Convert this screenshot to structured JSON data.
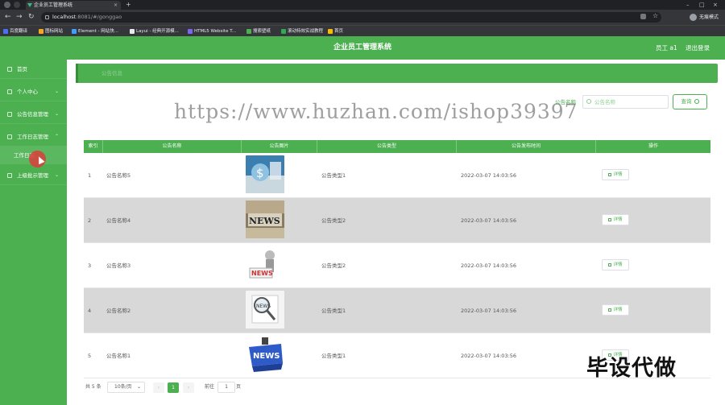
{
  "browser": {
    "tab_title": "企业员工管理系统",
    "tab_close": "×",
    "new_tab": "+",
    "url_host": "localhost",
    "url_rest": ":8081/#/gonggao",
    "profile_label": "无痕模式",
    "bookmarks": [
      {
        "label": "百度翻译",
        "color": "#4e6ef2"
      },
      {
        "label": "图标网站",
        "color": "#f5a623"
      },
      {
        "label": "Element - 网站快...",
        "color": "#409eff"
      },
      {
        "label": "Layui - 经典开源模...",
        "color": "#e8eaed"
      },
      {
        "label": "HTML5 Website T...",
        "color": "#7b68ee"
      },
      {
        "label": "搜索壁纸",
        "color": "#4caf50"
      },
      {
        "label": "滚动特效实战教程",
        "color": "#34a853"
      },
      {
        "label": "首页",
        "color": "#fbbc04"
      }
    ]
  },
  "header": {
    "title": "企业员工管理系统",
    "user": "员工 a1",
    "logout": "退出登录"
  },
  "sidebar": {
    "items": [
      {
        "label": "首页",
        "has_chevron": false
      },
      {
        "label": "个人中心",
        "has_chevron": true,
        "chevron": "⌄"
      },
      {
        "label": "公告信息管理",
        "has_chevron": true,
        "chevron": "⌄"
      },
      {
        "label": "工作日志管理",
        "has_chevron": true,
        "chevron": "⌃"
      },
      {
        "label": "上级批示管理",
        "has_chevron": true,
        "chevron": "⌄"
      }
    ],
    "sub_item": "工作日志"
  },
  "breadcrumb": "公告信息",
  "search": {
    "label": "公告名称",
    "placeholder": "公告名称",
    "button": "查询"
  },
  "table": {
    "columns": [
      "索引",
      "公告名称",
      "公告图片",
      "公告类型",
      "公告发布时间",
      "操作"
    ],
    "rows": [
      {
        "index": "1",
        "name": "公告名称5",
        "type": "公告类型1",
        "time": "2022-03-07 14:03:56",
        "action": "详情",
        "image": "dollar-image"
      },
      {
        "index": "2",
        "name": "公告名称4",
        "type": "公告类型2",
        "time": "2022-03-07 14:03:56",
        "action": "详情",
        "image": "news-letters-image"
      },
      {
        "index": "3",
        "name": "公告名称3",
        "type": "公告类型2",
        "time": "2022-03-07 14:03:56",
        "action": "详情",
        "image": "news-figure-image"
      },
      {
        "index": "4",
        "name": "公告名称2",
        "type": "公告类型1",
        "time": "2022-03-07 14:03:56",
        "action": "详情",
        "image": "news-magnifier-image"
      },
      {
        "index": "5",
        "name": "公告名称1",
        "type": "公告类型1",
        "time": "2022-03-07 14:03:56",
        "action": "详情",
        "image": "news-blue-image"
      }
    ]
  },
  "pagination": {
    "total": "共 5 条",
    "page_size": "10条/页",
    "prev": "‹",
    "current_page": "1",
    "next": "›",
    "goto_label": "前往",
    "goto_value": "1",
    "goto_suffix": "页"
  },
  "watermark": "https://www.huzhan.com/ishop39397",
  "bottom_brand": "毕设代做",
  "colors": {
    "primary": "#4caf50",
    "header_bg": "#4caf50",
    "row_even": "#d8d8d8"
  }
}
